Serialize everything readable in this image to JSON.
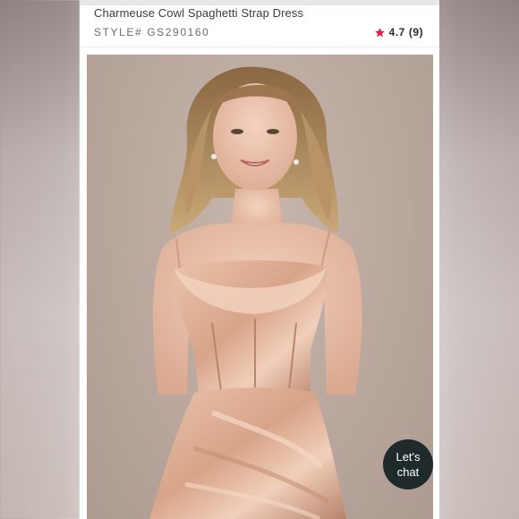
{
  "product": {
    "title": "Charmeuse Cowl Spaghetti Strap Dress",
    "style_label": "STYLE#",
    "style_number": "GS290160",
    "rating": "4.7",
    "review_count": "(9)",
    "star_icon": "star-icon",
    "star_color": "#d6244a"
  },
  "chat": {
    "line1": "Let's",
    "line2": "chat"
  },
  "image": {
    "alt": "Model wearing a rose gold charmeuse cowl neck spaghetti strap dress"
  }
}
